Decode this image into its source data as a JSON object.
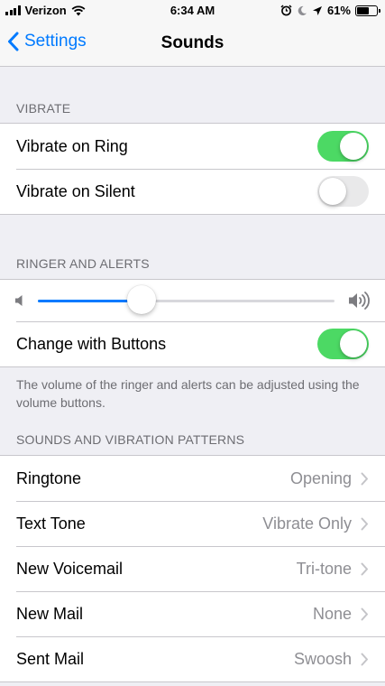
{
  "status_bar": {
    "carrier": "Verizon",
    "time": "6:34 AM",
    "battery": "61%",
    "battery_level": 0.61
  },
  "nav": {
    "back_label": "Settings",
    "title": "Sounds"
  },
  "vibrate": {
    "header": "VIBRATE",
    "items": [
      {
        "label": "Vibrate on Ring",
        "on": true
      },
      {
        "label": "Vibrate on Silent",
        "on": false
      }
    ]
  },
  "ringer": {
    "header": "RINGER AND ALERTS",
    "volume_level": 0.35,
    "change_with_buttons": {
      "label": "Change with Buttons",
      "on": true
    },
    "note": "The volume of the ringer and alerts can be adjusted using the volume buttons."
  },
  "patterns": {
    "header": "SOUNDS AND VIBRATION PATTERNS",
    "items": [
      {
        "label": "Ringtone",
        "value": "Opening"
      },
      {
        "label": "Text Tone",
        "value": "Vibrate Only"
      },
      {
        "label": "New Voicemail",
        "value": "Tri-tone"
      },
      {
        "label": "New Mail",
        "value": "None"
      },
      {
        "label": "Sent Mail",
        "value": "Swoosh"
      }
    ]
  },
  "colors": {
    "accent": "#007aff",
    "toggle_on": "#4cd964",
    "toggle_off": "#e9e9ea",
    "background": "#efeff4"
  }
}
